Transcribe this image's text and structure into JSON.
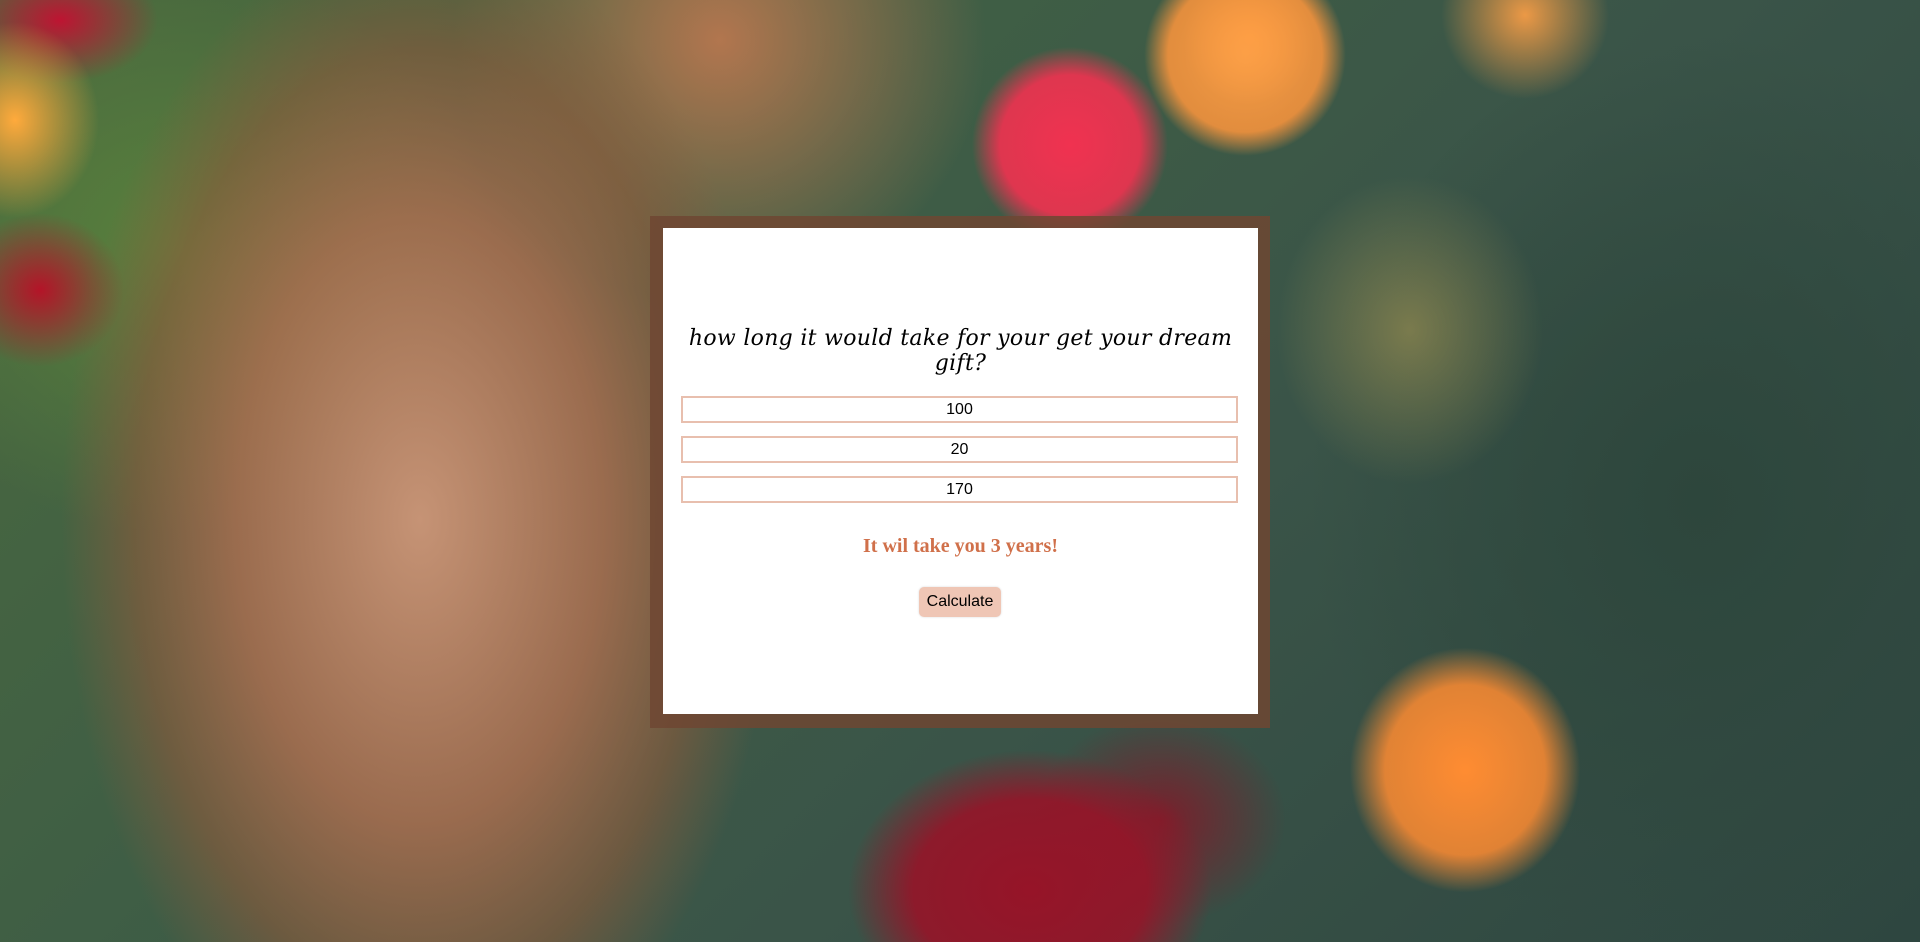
{
  "calculator": {
    "title": "how long it would take for your get your dream gift?",
    "fields": [
      {
        "value": "100"
      },
      {
        "value": "20"
      },
      {
        "value": "170"
      }
    ],
    "result": "It wil take you 3 years!",
    "button_label": "Calculate"
  },
  "colors": {
    "accent": "#d0704a",
    "button_bg": "#efc6b5",
    "field_border": "#e8bfae",
    "frame": "#6e4632"
  }
}
